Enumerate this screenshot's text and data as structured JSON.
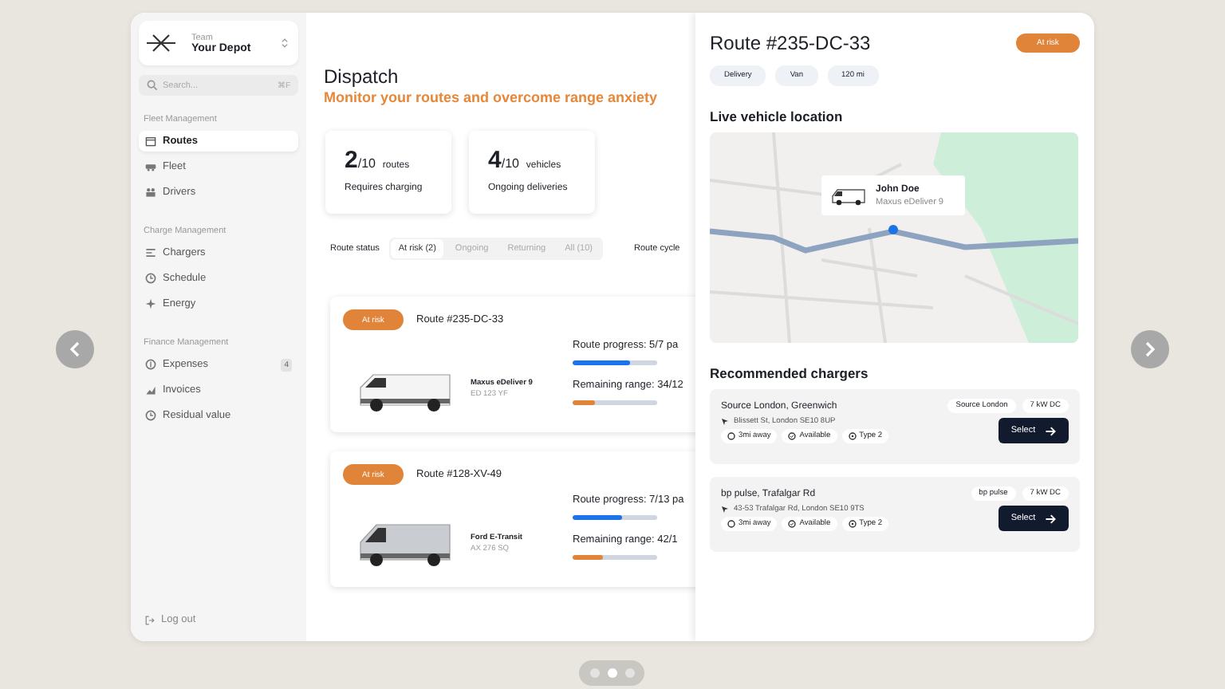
{
  "sidebar": {
    "team_label": "Team",
    "team_name": "Your Depot",
    "search": {
      "placeholder": "Search...",
      "shortcut": "⌘F"
    },
    "sections": [
      {
        "title": "Fleet Management",
        "items": [
          {
            "label": "Routes",
            "selected": true
          },
          {
            "label": "Fleet",
            "selected": false
          },
          {
            "label": "Drivers",
            "selected": false
          }
        ]
      },
      {
        "title": "Charge Management",
        "items": [
          {
            "label": "Chargers",
            "selected": false
          },
          {
            "label": "Schedule",
            "selected": false
          },
          {
            "label": "Energy",
            "selected": false
          }
        ]
      },
      {
        "title": "Finance Management",
        "items": [
          {
            "label": "Expenses",
            "selected": false,
            "badge": "4"
          },
          {
            "label": "Invoices",
            "selected": false
          },
          {
            "label": "Residual value",
            "selected": false
          }
        ]
      }
    ],
    "logout": "Log out"
  },
  "dispatch": {
    "title": "Dispatch",
    "subtitle": "Monitor your routes and overcome range anxiety",
    "stats": [
      {
        "value": "2",
        "total": "/10",
        "unit": "routes",
        "caption": "Requires charging"
      },
      {
        "value": "4",
        "total": "/10",
        "unit": "vehicles",
        "caption": "Ongoing deliveries"
      }
    ],
    "filter_label": "Route status",
    "tabs": [
      {
        "label": "At risk (2)",
        "selected": true
      },
      {
        "label": "Ongoing",
        "selected": false
      },
      {
        "label": "Returning",
        "selected": false
      },
      {
        "label": "All (10)",
        "selected": false
      }
    ],
    "cycle_label": "Route cycle",
    "routes": [
      {
        "status": "At risk",
        "route": "Route #235-DC-33",
        "vehicle": "Maxus eDeliver 9",
        "plate": "ED 123 YF",
        "progress": {
          "text": "Route progress: 5/7 pa",
          "level": 0.67
        },
        "range": {
          "text": "Remaining range: 34/12",
          "level": 0.27
        }
      },
      {
        "status": "At risk",
        "route": "Route #128-XV-49",
        "vehicle": "Ford E-Transit",
        "plate": "AX 276 SQ",
        "progress": {
          "text": "Route progress: 7/13 pa",
          "level": 0.58
        },
        "range": {
          "text": "Remaining range: 42/1",
          "level": 0.35
        }
      }
    ]
  },
  "detail": {
    "title": "Route #235-DC-33",
    "status": "At risk",
    "tags": [
      "Delivery",
      "Van",
      "120 mi"
    ],
    "location_heading": "Live vehicle location",
    "map": {
      "driver": "John Doe",
      "vehicle": "Maxus eDeliver 9"
    },
    "chargers_heading": "Recommended chargers",
    "chargers": [
      {
        "name": "Source London, Greenwich",
        "network": "Source London",
        "power": "7 kW DC",
        "address": "Blissett St, London SE10 8UP",
        "distance": "3mi away",
        "availability": "Available",
        "connector": "Type 2",
        "action": "Select"
      },
      {
        "name": "bp pulse, Trafalgar Rd",
        "network": "bp pulse",
        "power": "7 kW DC",
        "address": "43-53 Trafalgar Rd, London SE10 9TS",
        "distance": "3mi away",
        "availability": "Available",
        "connector": "Type 2",
        "action": "Select"
      }
    ]
  },
  "pager": [
    {
      "selected": false
    },
    {
      "selected": true
    },
    {
      "selected": false
    }
  ]
}
